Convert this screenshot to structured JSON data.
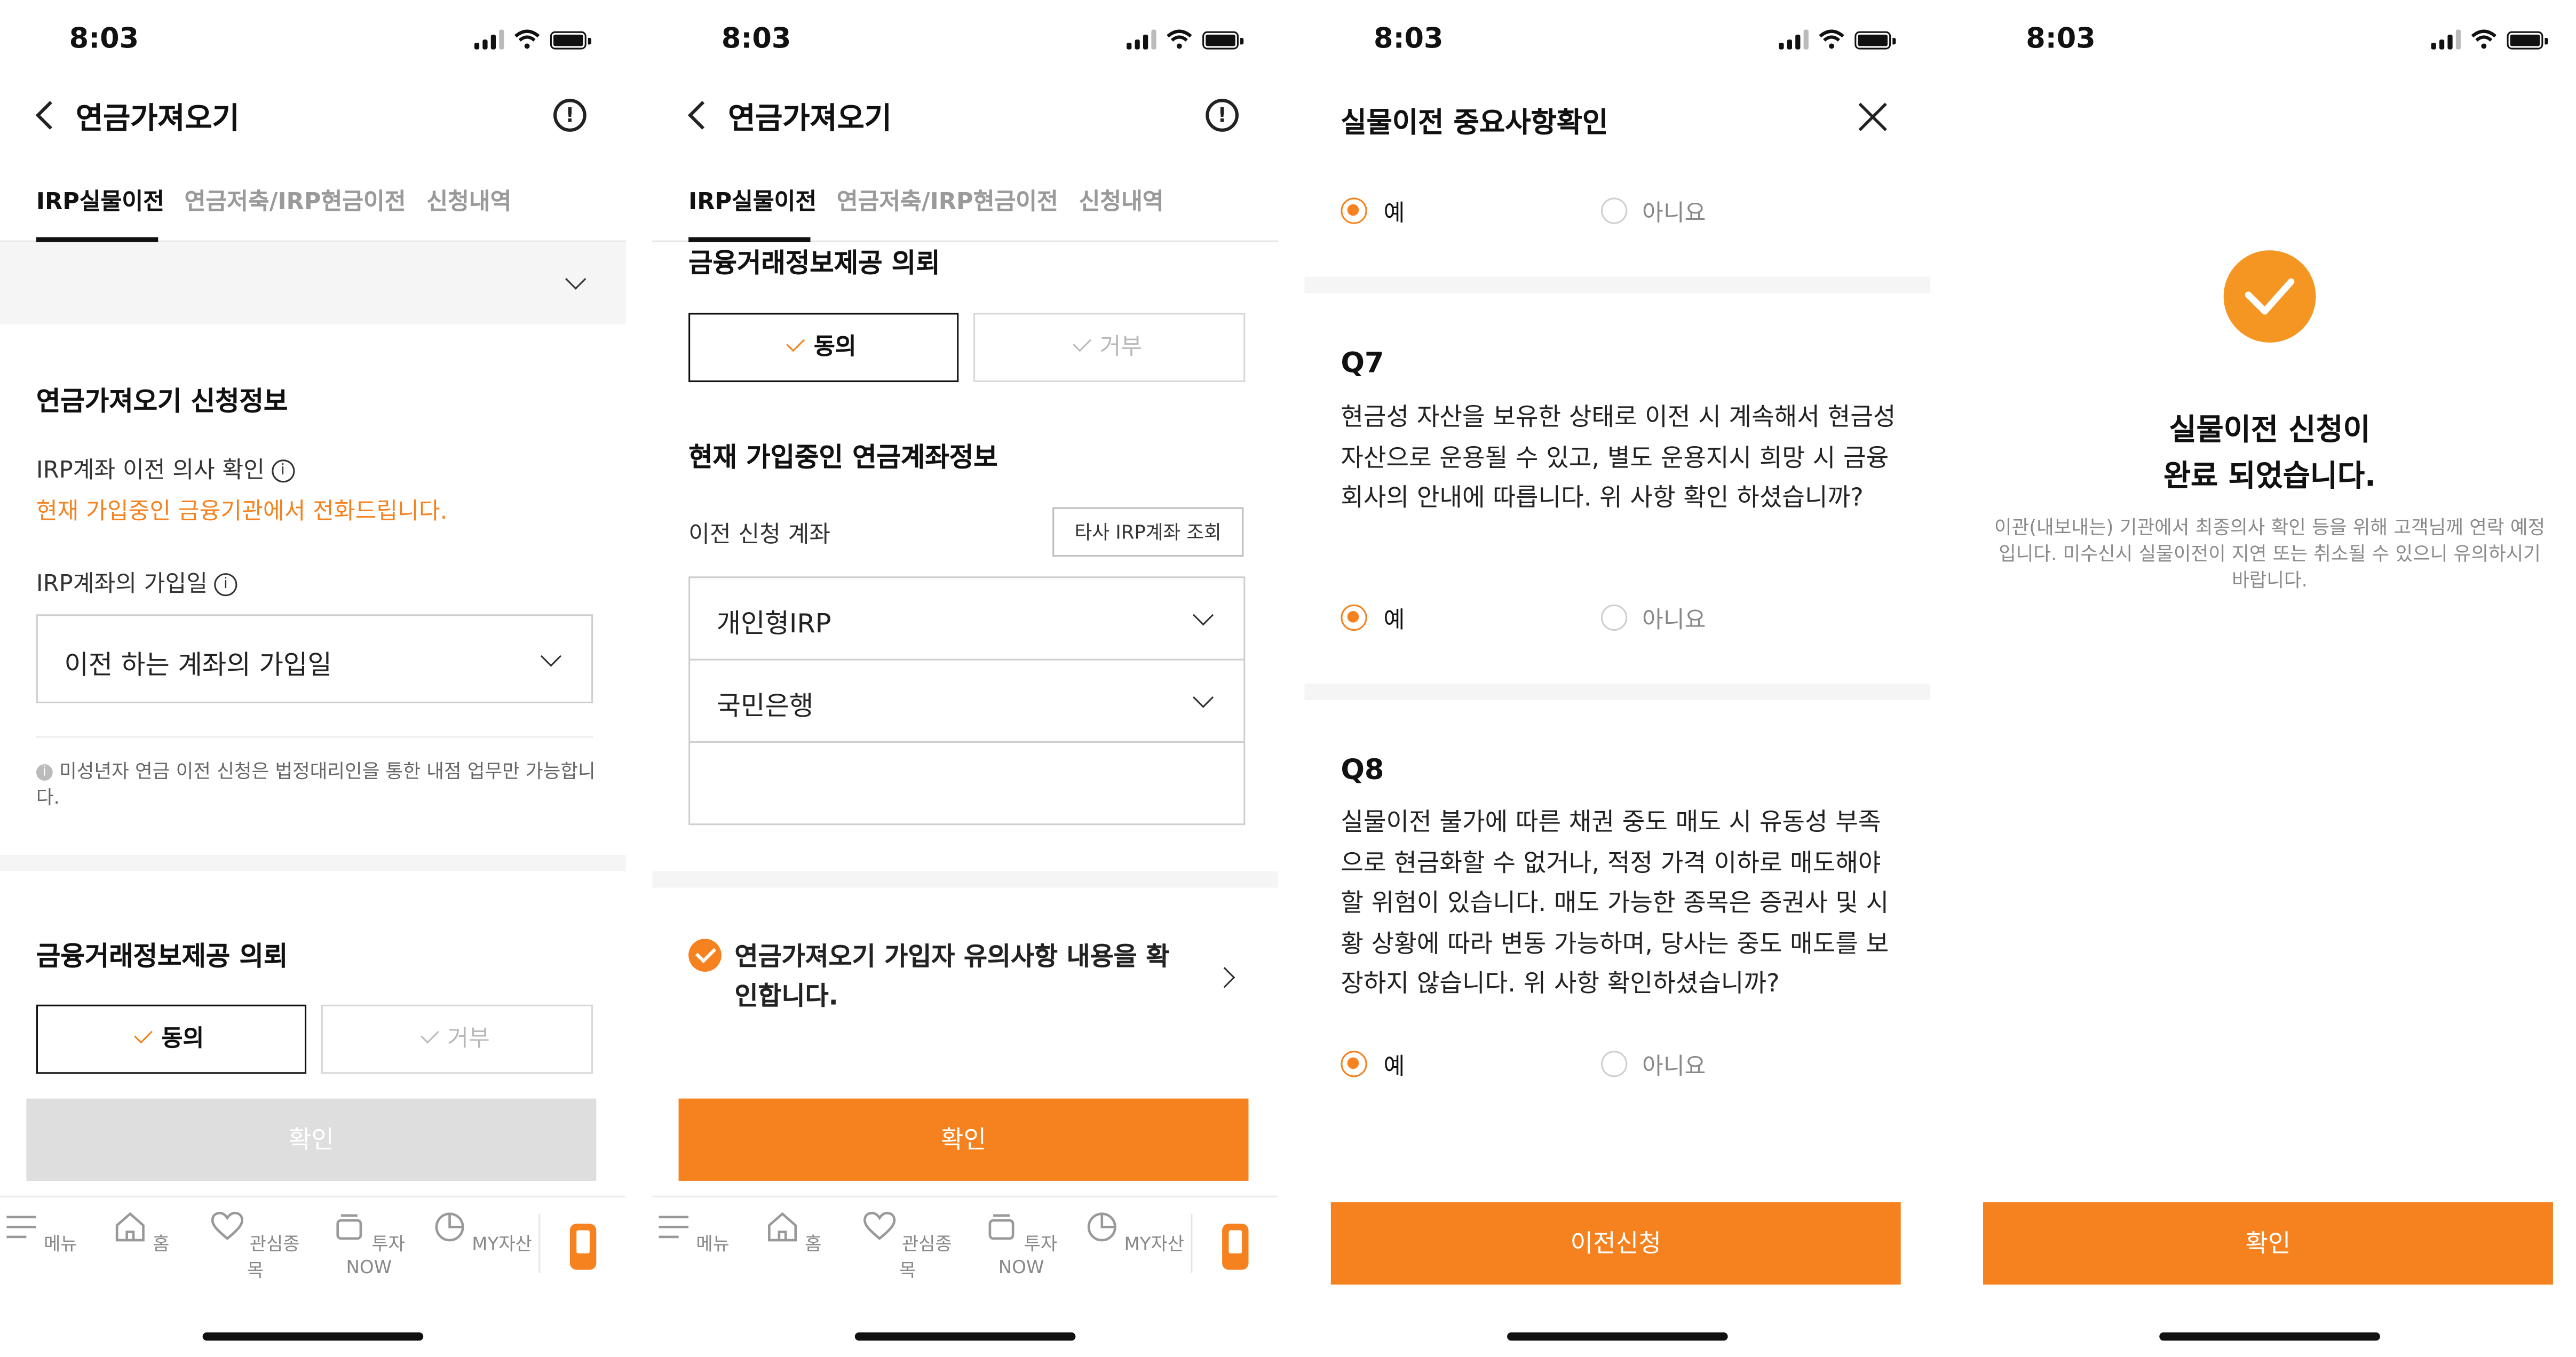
{
  "status_bar": {
    "time": "8:03"
  },
  "screen1": {
    "header": {
      "title": "연금가져오기"
    },
    "tabs": [
      "IRP실물이전",
      "연금저축/IRP현금이전",
      "신청내역"
    ],
    "section_title": "연금가져오기 신청정보",
    "irp_intent_label": "IRP계좌 이전 의사 확인",
    "irp_intent_note": "현재 가입중인 금융기관에서 전화드립니다.",
    "join_date_label": "IRP계좌의 가입일",
    "join_date_select": "이전 하는 계좌의 가입일",
    "minor_notice": "미성년자 연금 이전 신청은 법정대리인을 통한 내점 업무만 가능합니다.",
    "consent_title": "금융거래정보제공 의뢰",
    "agree": "동의",
    "reject": "거부",
    "confirm_button": "확인"
  },
  "screen2": {
    "header": {
      "title": "연금가져오기"
    },
    "tabs": [
      "IRP실물이전",
      "연금저축/IRP현금이전",
      "신청내역"
    ],
    "consent_title": "금융거래정보제공 의뢰",
    "agree": "동의",
    "reject": "거부",
    "account_info_title": "현재 가입중인 연금계좌정보",
    "transfer_account_label": "이전 신청 계좌",
    "lookup_button": "타사 IRP계좌 조회",
    "account_type": "개인형IRP",
    "bank": "국민은행",
    "account_number": "",
    "notice_check": "연금가져오기 가입자 유의사항 내용을 확인합니다.",
    "confirm_button": "확인"
  },
  "screen3": {
    "title": "실물이전 중요사항확인",
    "yes": "예",
    "no": "아니요",
    "q7": {
      "title": "Q7",
      "body": "현금성 자산을 보유한 상태로 이전 시 계속해서 현금성 자산으로 운용될 수 있고, 별도 운용지시 희망 시 금융회사의 안내에 따릅니다. 위 사항 확인 하셨습니까?"
    },
    "q8": {
      "title": "Q8",
      "body": "실물이전 불가에 따른 채권 중도 매도 시 유동성 부족으로 현금화할 수 없거나, 적정 가격 이하로 매도해야 할 위험이 있습니다. 매도 가능한 종목은 증권사 및 시황 상황에 따라 변동 가능하며, 당사는 중도 매도를 보장하지 않습니다. 위 사항 확인하셨습니까?"
    },
    "submit_button": "이전신청"
  },
  "screen4": {
    "title_line1": "실물이전 신청이",
    "title_line2": "완료 되었습니다.",
    "description": "이관(내보내는) 기관에서 최종의사 확인 등을 위해 고객님께 연락 예정입니다. 미수신시 실물이전이 지연 또는 취소될 수 있으니 유의하시기 바랍니다.",
    "confirm_button": "확인"
  },
  "bottom_nav": [
    {
      "label": "메뉴",
      "icon": "menu-icon"
    },
    {
      "label": "홈",
      "icon": "home-icon"
    },
    {
      "label": "관심종목",
      "icon": "heart-icon"
    },
    {
      "label": "투자NOW",
      "icon": "stack-icon"
    },
    {
      "label": "MY자산",
      "icon": "pie-chart-icon"
    }
  ],
  "colors": {
    "accent": "#f5821f",
    "text": "#1a1a1a",
    "disabled": "#dedede"
  }
}
